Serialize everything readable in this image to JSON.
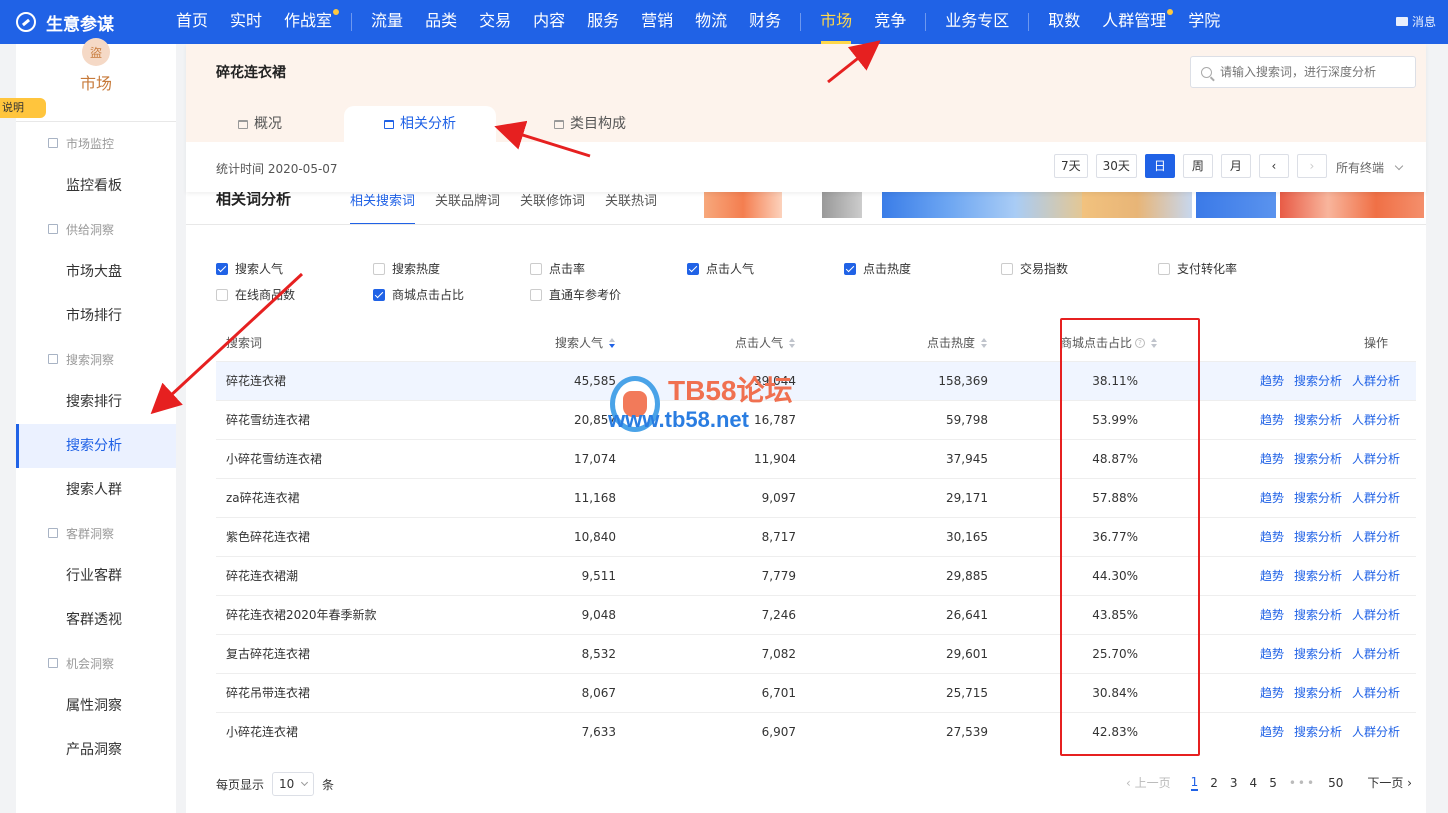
{
  "brand": {
    "name": "生意参谋"
  },
  "topnav": [
    {
      "label": "首页",
      "dot": false,
      "active": false,
      "sep_after": false
    },
    {
      "label": "实时",
      "dot": false,
      "active": false,
      "sep_after": false
    },
    {
      "label": "作战室",
      "dot": true,
      "active": false,
      "sep_after": true
    },
    {
      "label": "流量",
      "dot": false,
      "active": false,
      "sep_after": false
    },
    {
      "label": "品类",
      "dot": false,
      "active": false,
      "sep_after": false
    },
    {
      "label": "交易",
      "dot": false,
      "active": false,
      "sep_after": false
    },
    {
      "label": "内容",
      "dot": false,
      "active": false,
      "sep_after": false
    },
    {
      "label": "服务",
      "dot": false,
      "active": false,
      "sep_after": false
    },
    {
      "label": "营销",
      "dot": false,
      "active": false,
      "sep_after": false
    },
    {
      "label": "物流",
      "dot": false,
      "active": false,
      "sep_after": false
    },
    {
      "label": "财务",
      "dot": false,
      "active": false,
      "sep_after": true
    },
    {
      "label": "市场",
      "dot": false,
      "active": true,
      "sep_after": false
    },
    {
      "label": "竞争",
      "dot": false,
      "active": false,
      "sep_after": true
    },
    {
      "label": "业务专区",
      "dot": false,
      "active": false,
      "sep_after": true
    },
    {
      "label": "取数",
      "dot": false,
      "active": false,
      "sep_after": false
    },
    {
      "label": "人群管理",
      "dot": true,
      "active": false,
      "sep_after": false
    },
    {
      "label": "学院",
      "dot": false,
      "active": false,
      "sep_after": false
    }
  ],
  "message_label": "消息",
  "side_tab_label": "说明",
  "sidebar": {
    "title": "市场",
    "avatar_glyph": "盜",
    "groups": [
      {
        "label": "市场监控",
        "items": [
          {
            "label": "监控看板",
            "active": false
          }
        ]
      },
      {
        "label": "供给洞察",
        "items": [
          {
            "label": "市场大盘",
            "active": false
          },
          {
            "label": "市场排行",
            "active": false
          }
        ]
      },
      {
        "label": "搜索洞察",
        "items": [
          {
            "label": "搜索排行",
            "active": false
          },
          {
            "label": "搜索分析",
            "active": true
          },
          {
            "label": "搜索人群",
            "active": false
          }
        ]
      },
      {
        "label": "客群洞察",
        "items": [
          {
            "label": "行业客群",
            "active": false
          },
          {
            "label": "客群透视",
            "active": false
          }
        ]
      },
      {
        "label": "机会洞察",
        "items": [
          {
            "label": "属性洞察",
            "active": false
          },
          {
            "label": "产品洞察",
            "active": false
          }
        ]
      }
    ]
  },
  "header": {
    "title": "碎花连衣裙",
    "search_placeholder": "请输入搜索词，进行深度分析",
    "tabs": [
      {
        "label": "概况",
        "active": false
      },
      {
        "label": "相关分析",
        "active": true
      },
      {
        "label": "类目构成",
        "active": false
      }
    ],
    "stat_time": "统计时间 2020-05-07",
    "periods": [
      {
        "label": "7天",
        "state": "normal"
      },
      {
        "label": "30天",
        "state": "normal"
      },
      {
        "label": "日",
        "state": "active"
      },
      {
        "label": "周",
        "state": "normal"
      },
      {
        "label": "月",
        "state": "normal"
      },
      {
        "label": "‹",
        "state": "normal"
      },
      {
        "label": "›",
        "state": "disabled"
      }
    ],
    "terminal": "所有终端"
  },
  "related": {
    "title": "相关词分析",
    "subtabs": [
      {
        "label": "相关搜索词",
        "active": true
      },
      {
        "label": "关联品牌词",
        "active": false
      },
      {
        "label": "关联修饰词",
        "active": false
      },
      {
        "label": "关联热词",
        "active": false
      }
    ]
  },
  "filters": [
    {
      "label": "搜索人气",
      "checked": true
    },
    {
      "label": "搜索热度",
      "checked": false
    },
    {
      "label": "点击率",
      "checked": false
    },
    {
      "label": "点击人气",
      "checked": true
    },
    {
      "label": "点击热度",
      "checked": true
    },
    {
      "label": "交易指数",
      "checked": false
    },
    {
      "label": "支付转化率",
      "checked": false
    },
    {
      "label": "在线商品数",
      "checked": false
    },
    {
      "label": "商城点击占比",
      "checked": true
    },
    {
      "label": "直通车参考价",
      "checked": false
    }
  ],
  "table": {
    "columns": [
      "搜索词",
      "搜索人气",
      "点击人气",
      "点击热度",
      "商城点击占比",
      "操作"
    ],
    "ops": [
      "趋势",
      "搜索分析",
      "人群分析"
    ],
    "rows": [
      [
        "碎花连衣裙",
        "45,585",
        "39,044",
        "158,369",
        "38.11%"
      ],
      [
        "碎花雪纺连衣裙",
        "20,857",
        "16,787",
        "59,798",
        "53.99%"
      ],
      [
        "小碎花雪纺连衣裙",
        "17,074",
        "11,904",
        "37,945",
        "48.87%"
      ],
      [
        "za碎花连衣裙",
        "11,168",
        "9,097",
        "29,171",
        "57.88%"
      ],
      [
        "紫色碎花连衣裙",
        "10,840",
        "8,717",
        "30,165",
        "36.77%"
      ],
      [
        "碎花连衣裙潮",
        "9,511",
        "7,779",
        "29,885",
        "44.30%"
      ],
      [
        "碎花连衣裙2020年春季新款",
        "9,048",
        "7,246",
        "26,641",
        "43.85%"
      ],
      [
        "复古碎花连衣裙",
        "8,532",
        "7,082",
        "29,601",
        "25.70%"
      ],
      [
        "碎花吊带连衣裙",
        "8,067",
        "6,701",
        "25,715",
        "30.84%"
      ],
      [
        "小碎花连衣裙",
        "7,633",
        "6,907",
        "27,539",
        "42.83%"
      ]
    ]
  },
  "pagination": {
    "per_page_label": "每页显示",
    "per_page_value": "10",
    "per_page_unit": "条",
    "prev": "‹ 上一页",
    "pages": [
      "1",
      "2",
      "3",
      "4",
      "5"
    ],
    "dots": "•••",
    "last": "50",
    "next": "下一页 ›"
  },
  "watermark": {
    "line1": "TB58论坛",
    "line2": "www.tb58.net"
  },
  "colors": {
    "brand_blue": "#2062e6",
    "nav_active": "#ffd84a",
    "annotation_red": "#e62020"
  }
}
